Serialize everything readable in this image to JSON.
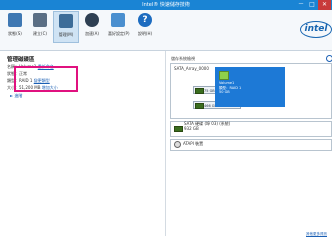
{
  "window": {
    "title": "Intel® 快速儲存技術",
    "controls": [
      "－",
      "□",
      "✕"
    ]
  },
  "toolbar": {
    "buttons": [
      {
        "label": "狀態(S)",
        "icon": "status-icon"
      },
      {
        "label": "建立(C)",
        "icon": "create-icon"
      },
      {
        "label": "管理(M)",
        "icon": "manage-icon",
        "active": true
      },
      {
        "label": "加速(A)",
        "icon": "accelerate-icon"
      },
      {
        "label": "喜好設定(P)",
        "icon": "preferences-icon"
      },
      {
        "label": "說明(H)",
        "icon": "help-icon"
      }
    ],
    "brand": "intel"
  },
  "left": {
    "heading": "管理磁碟區",
    "line1_label": "名稱：Volume1",
    "line1_link": "重新命名",
    "line2": "狀態：正常",
    "line3": "類型：RAID 1",
    "line3_link": "變更類型",
    "line4": "大小：51,200 MB",
    "line4_link": "增加大小",
    "advanced": "► 進階"
  },
  "right": {
    "heading": "儲存系統檢視",
    "array_name": "SATA_Array_0000",
    "disk1": "75 GB",
    "disk2": "466 GB",
    "volume_lines": [
      "Volume1",
      "類型：RAID 1",
      "50 GB"
    ],
    "sata_disk_lines": [
      "SATA 硬碟 (埠 03) (系統)",
      "932 GB"
    ],
    "atapi": "ATAPI 裝置",
    "footer_link": "其他更多資訊"
  },
  "colors": {
    "titlebar": "#1a84d4",
    "highlight": "#e0117f",
    "volume": "#1d79d6"
  }
}
